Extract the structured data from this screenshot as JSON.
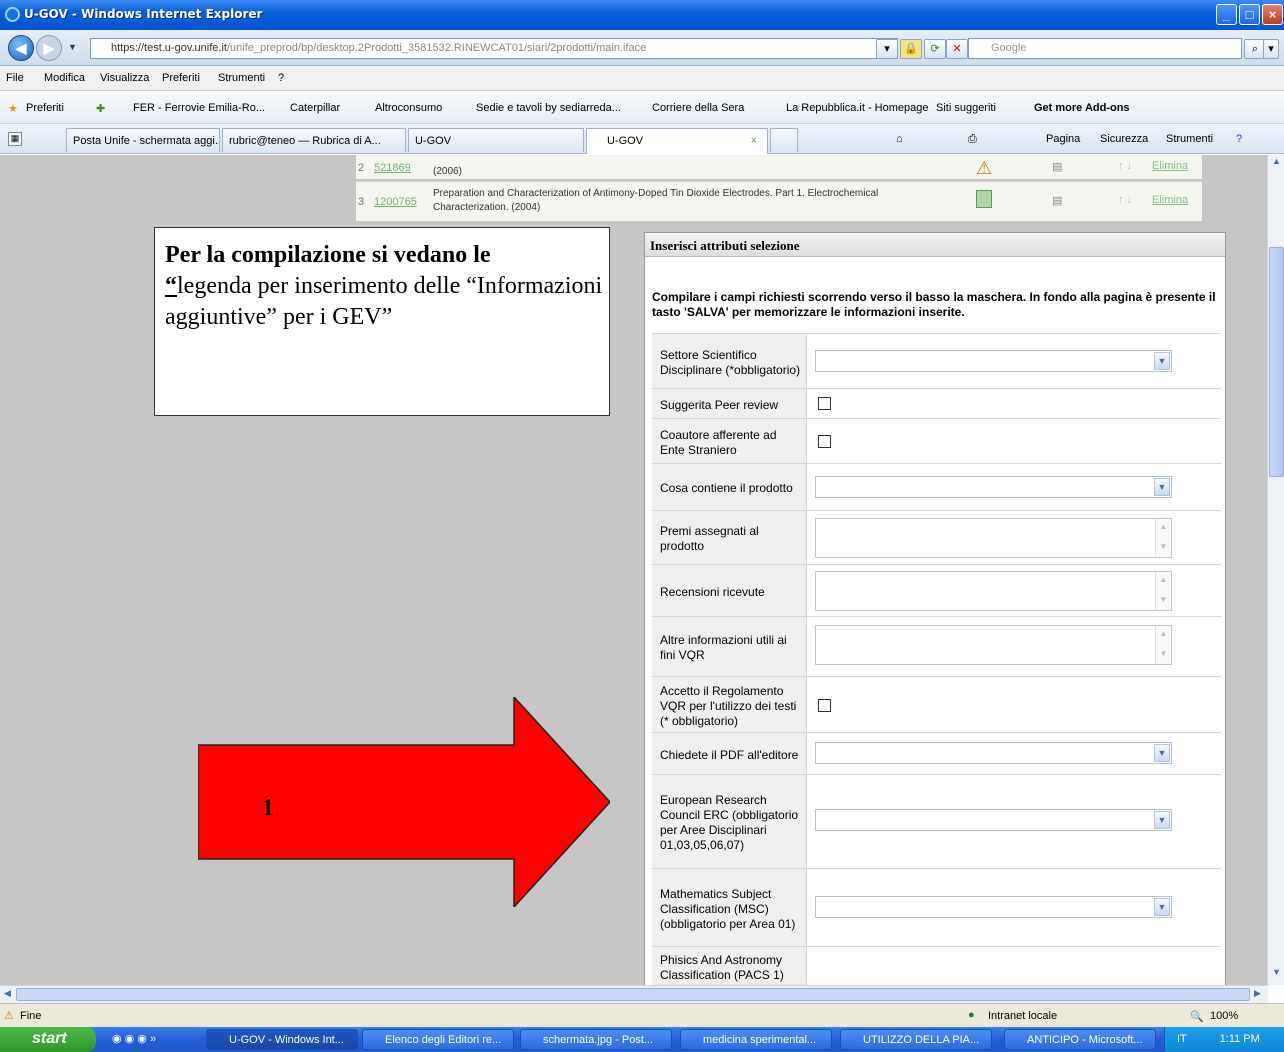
{
  "window": {
    "title": "U-GOV - Windows Internet Explorer"
  },
  "address": {
    "url_main": "https://test.u-gov.unife.it",
    "url_rest": "/unife_preprod/bp/desktop.2Prodotti_3581532.RINEWCAT01/siari/2prodotti/main.iface",
    "search_placeholder": "Google"
  },
  "menu": [
    "File",
    "Modifica",
    "Visualizza",
    "Preferiti",
    "Strumenti",
    "?"
  ],
  "favorites": {
    "label": "Preferiti",
    "items": [
      "FER - Ferrovie Emilia-Ro...",
      "Caterpillar",
      "Altroconsumo",
      "Sedie e tavoli by sediarreda...",
      "Corriere della Sera",
      "La Repubblica.it - Homepage",
      "Siti suggeriti",
      "Get more Add-ons"
    ]
  },
  "tabs": [
    "Posta Unife - schermata aggi...",
    "rubric@teneo — Rubrica di A...",
    "U-GOV",
    "U-GOV"
  ],
  "commands": [
    "Pagina",
    "Sicurezza",
    "Strumenti"
  ],
  "rows": [
    {
      "num": "2",
      "id": "521869",
      "title_line": "(2006)",
      "action": "Elimina"
    },
    {
      "num": "3",
      "id": "1200765",
      "title_line1": "Preparation and Characterization of Antimony-Doped Tin Dioxide Electrodes. Part 1. Electrochemical",
      "title_line2": "Characterization. (2004)",
      "action": "Elimina"
    }
  ],
  "note": {
    "bold": "Per la compilazione si vedano le",
    "quote_open": "“",
    "text": "legenda per inserimento delle “Informazioni aggiuntive” per i GEV”"
  },
  "arrow": {
    "label": "1",
    "color": "#ff0000"
  },
  "panel": {
    "title": "Inserisci attributi selezione",
    "intro": "Compilare i campi richiesti scorrendo verso il basso la maschera. In fondo alla pagina è presente il tasto 'SALVA' per memorizzare le informazioni inserite.",
    "fields": {
      "ssd": "Settore Scientifico Disciplinare (*obbligatorio)",
      "peer": "Suggerita Peer review",
      "coautore": "Coautore afferente ad Ente Straniero",
      "cosa": "Cosa contiene il prodotto",
      "premi": "Premi assegnati al prodotto",
      "recensioni": "Recensioni ricevute",
      "altre": "Altre informazioni utili ai fini VQR",
      "accetto": "Accetto il Regolamento VQR per l'utilizzo dei testi (* obbligatorio)",
      "pdf": "Chiedete il PDF all'editore",
      "erc": "European Research Council ERC (obbligatorio per Aree Disciplinari 01,03,05,06,07)",
      "msc": "Mathematics Subject Classification (MSC) (obbligatorio per Area 01)",
      "pacs": "Phisics And Astronomy Classification (PACS 1)"
    }
  },
  "status": {
    "left": "Fine",
    "zone": "Intranet locale",
    "zoom": "100%"
  },
  "taskbar": {
    "start": "start",
    "tasks": [
      "U-GOV - Windows Int...",
      "Elenco degli Editori re...",
      "schermata.jpg - Post...",
      "medicina sperimental...",
      "UTILIZZO DELLA PIA...",
      "ANTICIPO - Microsoft..."
    ],
    "lang": "IT",
    "clock": "1:11 PM"
  }
}
